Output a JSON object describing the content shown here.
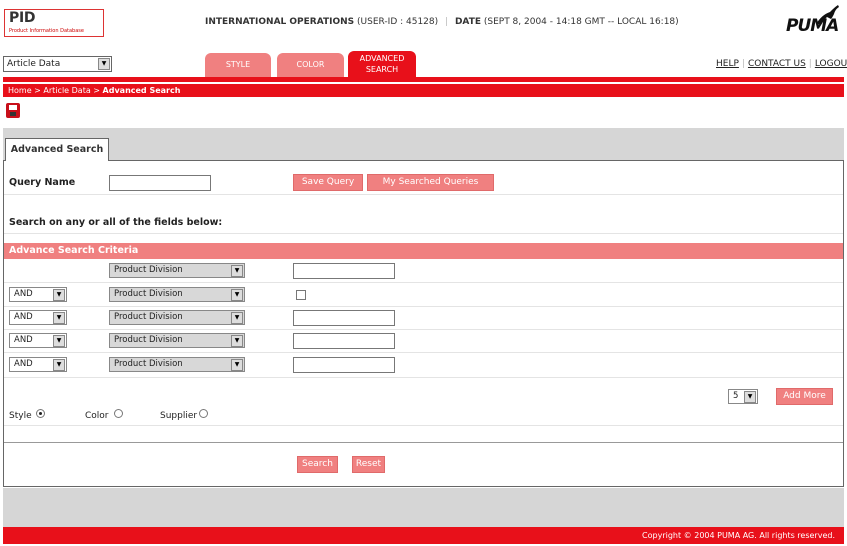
{
  "header": {
    "logo_title": "PID",
    "logo_subtitle": "Product Information Database",
    "org": "INTERNATIONAL OPERATIONS",
    "user_id": "(USER-ID : 45128)",
    "date_label": "DATE",
    "date_value": "(SEPT 8, 2004 - 14:18 GMT -- LOCAL 16:18)",
    "brand": "PUMA"
  },
  "nav": {
    "module_select": "Article Data",
    "tabs": [
      "STYLE",
      "COLOR",
      "ADVANCED SEARCH"
    ],
    "links": [
      "HELP",
      "CONTACT US",
      "LOGOUT"
    ]
  },
  "breadcrumb": {
    "home": "Home",
    "parent": "Article Data",
    "current": "Advanced Search",
    "sep": " > "
  },
  "panel": {
    "tab": "Advanced Search",
    "query_name_label": "Query Name",
    "query_name_value": "",
    "save_query": "Save Query",
    "my_searched_queries": "My Searched Queries",
    "instructions": "Search on any or all of the fields below:",
    "criteria_title": "Advance Search Criteria",
    "rows": [
      {
        "op": "",
        "field": "Product Division",
        "value": ""
      },
      {
        "op": "AND",
        "field": "Product Division",
        "value": ""
      },
      {
        "op": "AND",
        "field": "Product Division",
        "value": ""
      },
      {
        "op": "AND",
        "field": "Product Division",
        "value": ""
      },
      {
        "op": "AND",
        "field": "Product Division",
        "value": ""
      }
    ],
    "add_count": "5",
    "add_more": "Add More",
    "result_types": [
      {
        "label": "Style",
        "selected": true
      },
      {
        "label": "Color",
        "selected": false
      },
      {
        "label": "Supplier",
        "selected": false
      }
    ],
    "search": "Search",
    "reset": "Reset"
  },
  "footer": {
    "copyright": "Copyright © 2004 PUMA AG. All rights reserved."
  }
}
